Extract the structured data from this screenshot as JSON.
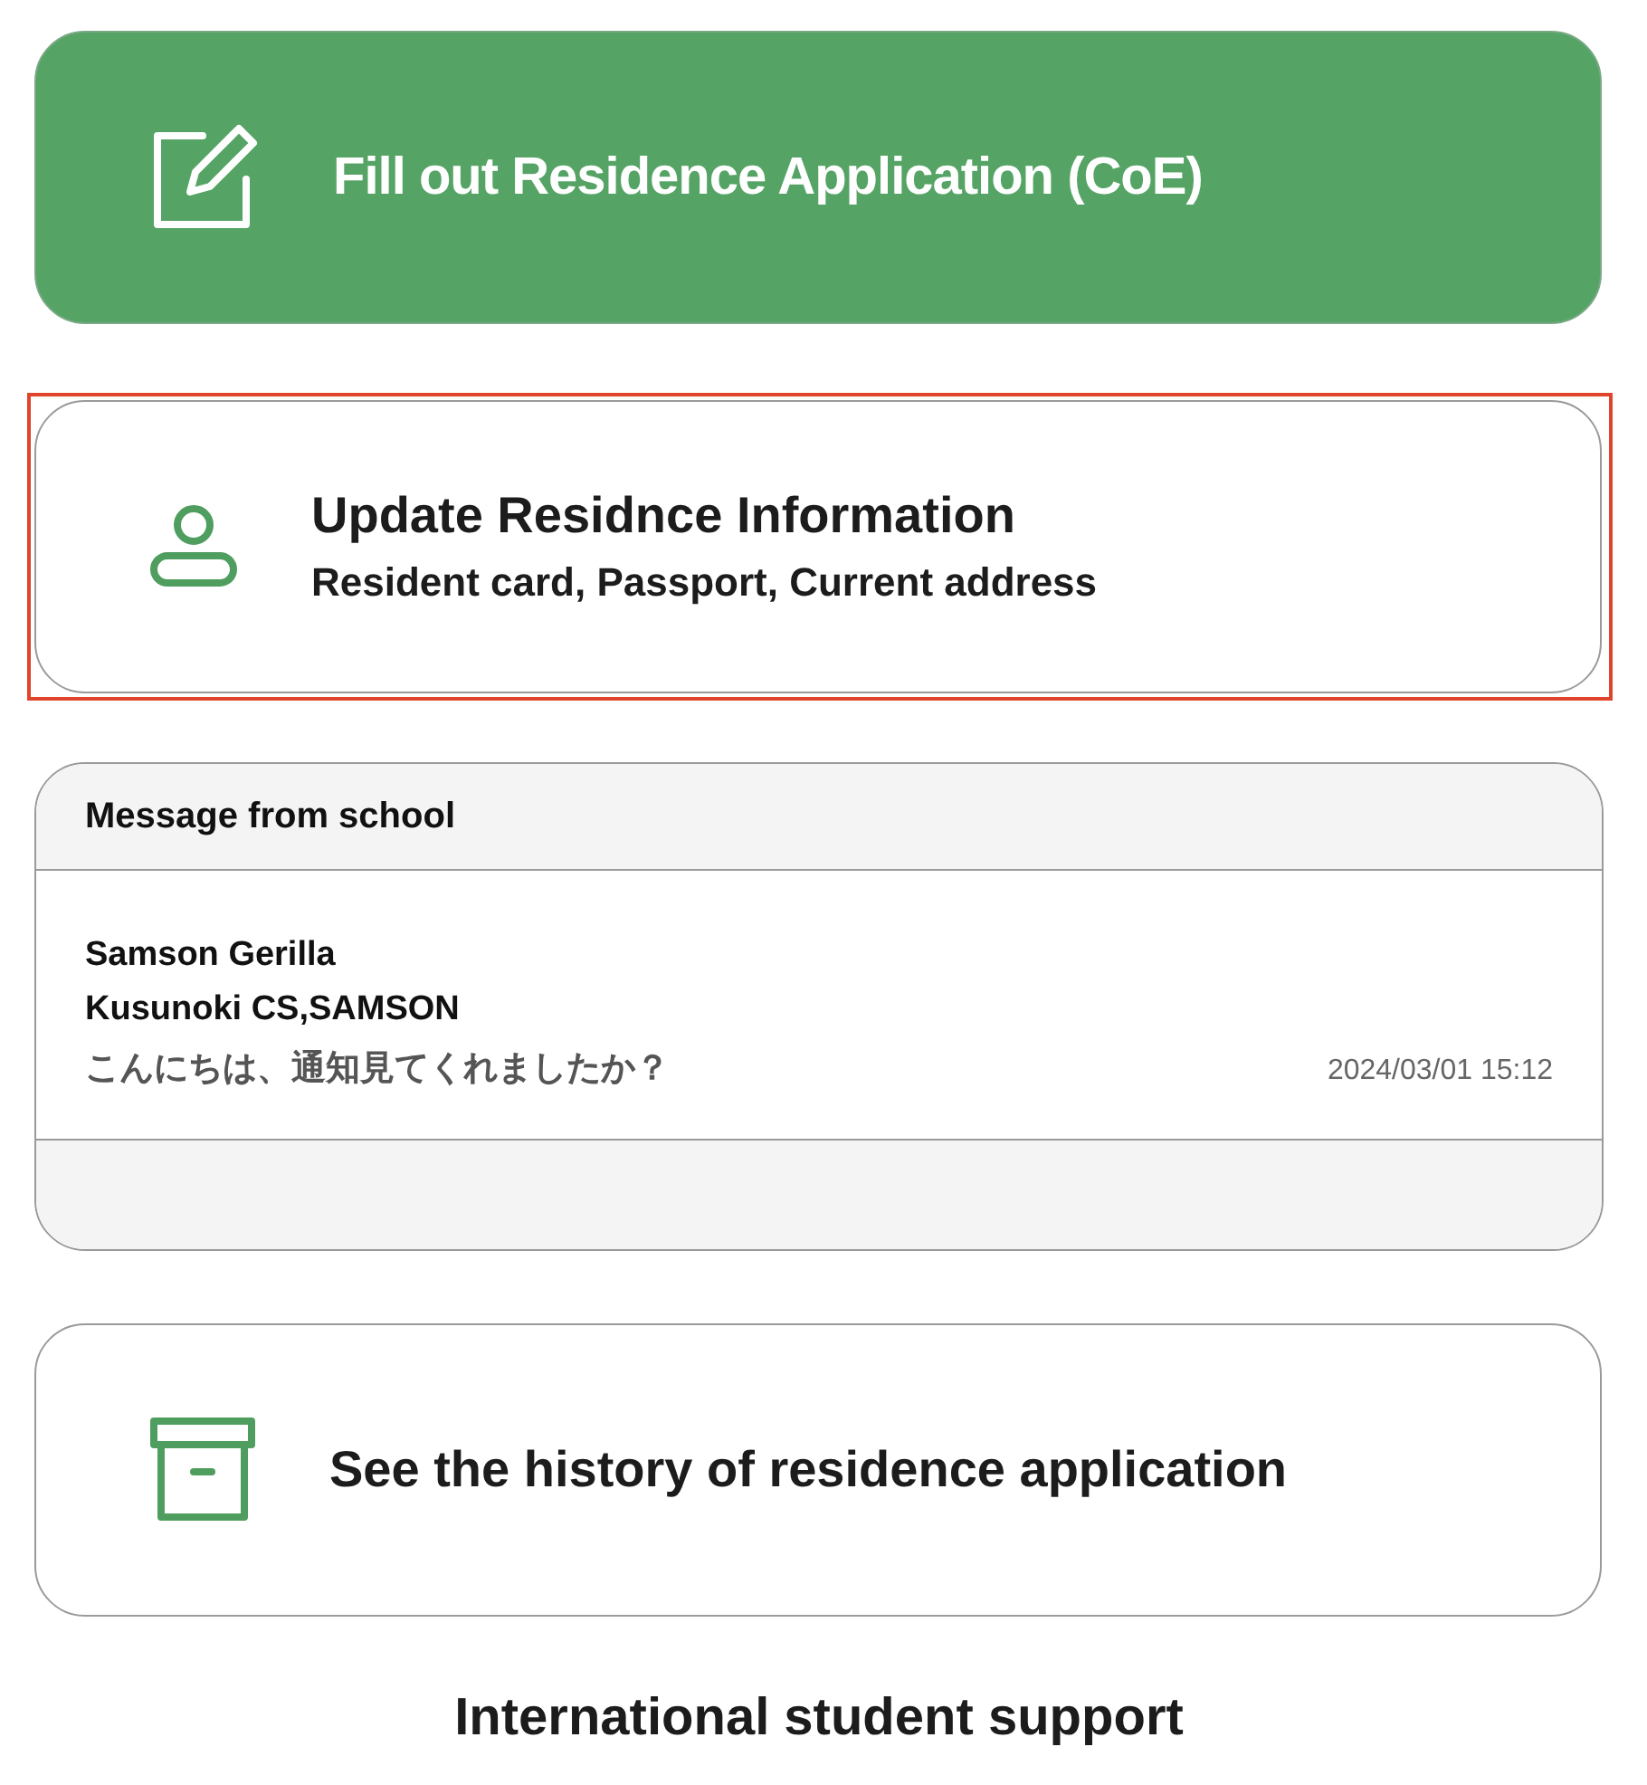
{
  "actions_top": [
    {
      "kind": "application",
      "title": "Fill out Residence Application (CoE)",
      "highlighted": false
    },
    {
      "kind": "profile",
      "title": "Update Residnce Information",
      "subtitle": "Resident card, Passport, Current address",
      "highlighted": true
    }
  ],
  "messages": {
    "title": "Message from school",
    "items": [
      {
        "sender": "Samson Gerilla",
        "school": "Kusunoki CS,SAMSON",
        "text": "こんにちは、通知見てくれましたか？",
        "time": "2024/03/01 15:12"
      }
    ]
  },
  "actions_bottom": [
    {
      "kind": "history",
      "title": "See the history of residence application",
      "highlighted": false
    }
  ],
  "footer": "International student support"
}
